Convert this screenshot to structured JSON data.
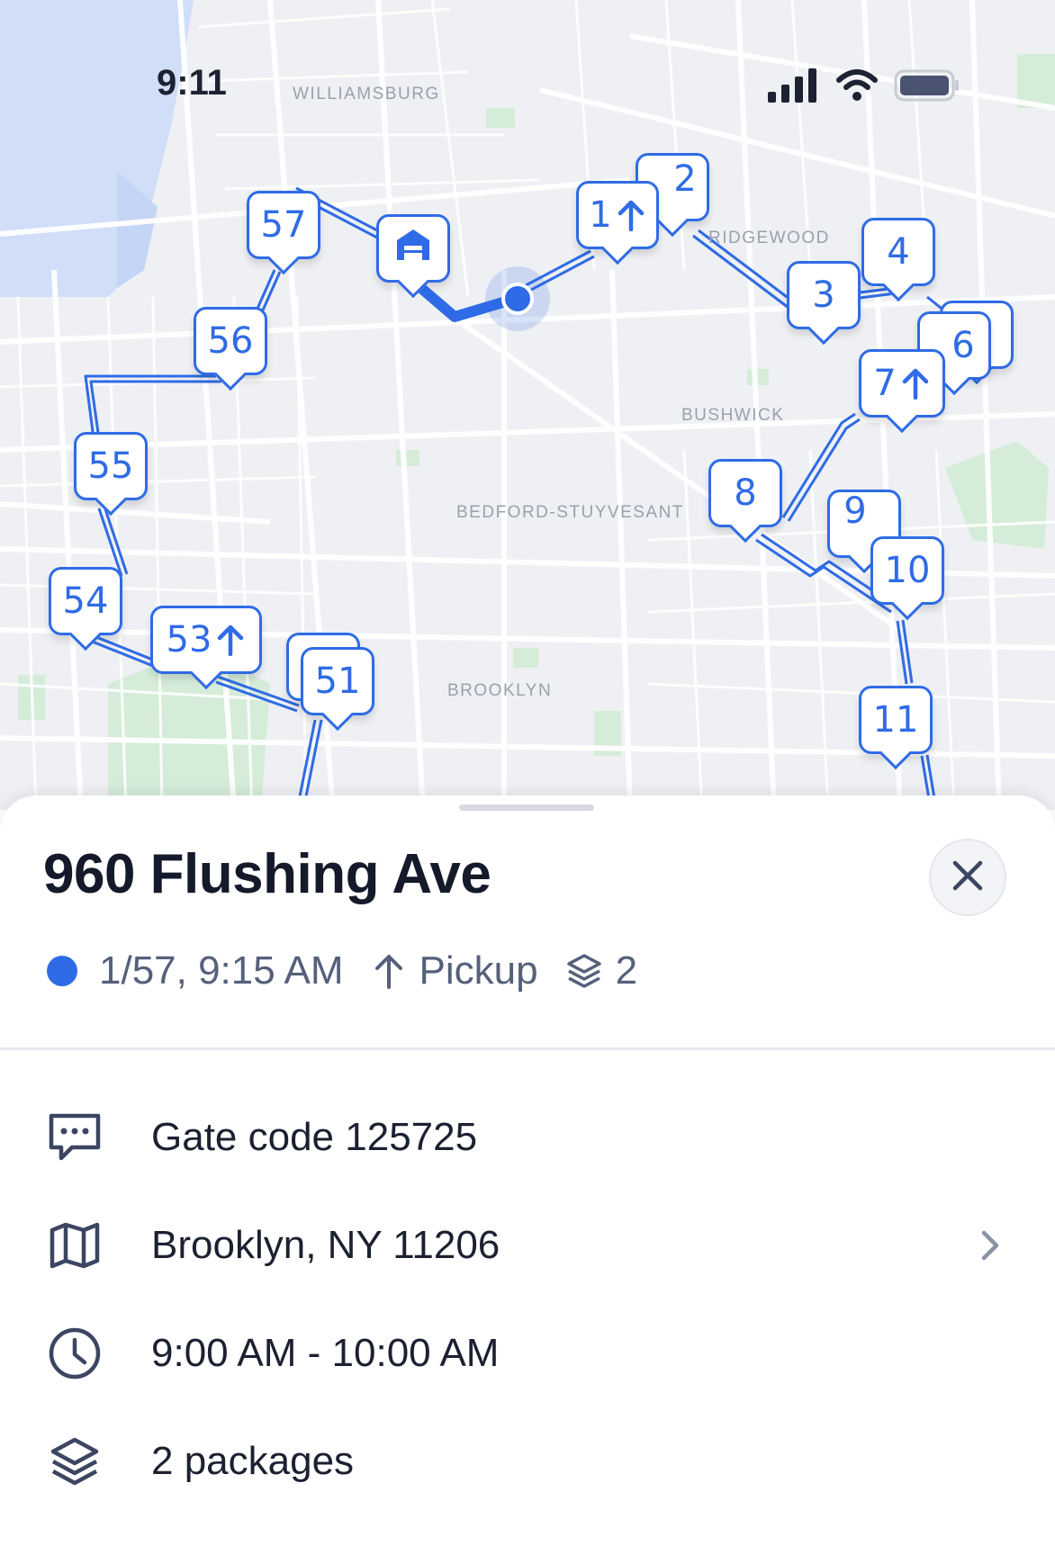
{
  "status_bar": {
    "time": "9:11",
    "icons": [
      "signal-icon",
      "wifi-icon",
      "battery-icon"
    ]
  },
  "map": {
    "districts": [
      "WILLIAMSBURG",
      "RIDGEWOOD",
      "BUSHWICK",
      "BEDFORD-STUYVESANT",
      "BROOKLYN"
    ],
    "stops": [
      {
        "label": "57",
        "pickup": false
      },
      {
        "label": "56",
        "pickup": false
      },
      {
        "label": "55",
        "pickup": false
      },
      {
        "label": "54",
        "pickup": false
      },
      {
        "label": "53",
        "pickup": true
      },
      {
        "label": "51",
        "pickup": false
      },
      {
        "label": "1",
        "pickup": true
      },
      {
        "label": "2",
        "pickup": false
      },
      {
        "label": "3",
        "pickup": false
      },
      {
        "label": "4",
        "pickup": false
      },
      {
        "label": "6",
        "pickup": false
      },
      {
        "label": "7",
        "pickup": true
      },
      {
        "label": "8",
        "pickup": false
      },
      {
        "label": "9",
        "pickup": false
      },
      {
        "label": "10",
        "pickup": false
      },
      {
        "label": "11",
        "pickup": false
      }
    ],
    "depot_icon": "warehouse-icon",
    "colors": {
      "route": "#2f6be6",
      "background": "#eef0f3",
      "park": "#d5ecd9",
      "water": "#d0def8"
    }
  },
  "sheet": {
    "title": "960 Flushing Ave",
    "meta": {
      "stop_time": "1/57, 9:15 AM",
      "type": "Pickup",
      "package_count": "2"
    },
    "details": [
      {
        "icon": "message-icon",
        "text": "Gate code 125725"
      },
      {
        "icon": "map-icon",
        "text": "Brooklyn, NY 11206"
      },
      {
        "icon": "clock-icon",
        "text": "9:00 AM - 10:00 AM"
      },
      {
        "icon": "layers-icon",
        "text": "2 packages"
      }
    ]
  }
}
